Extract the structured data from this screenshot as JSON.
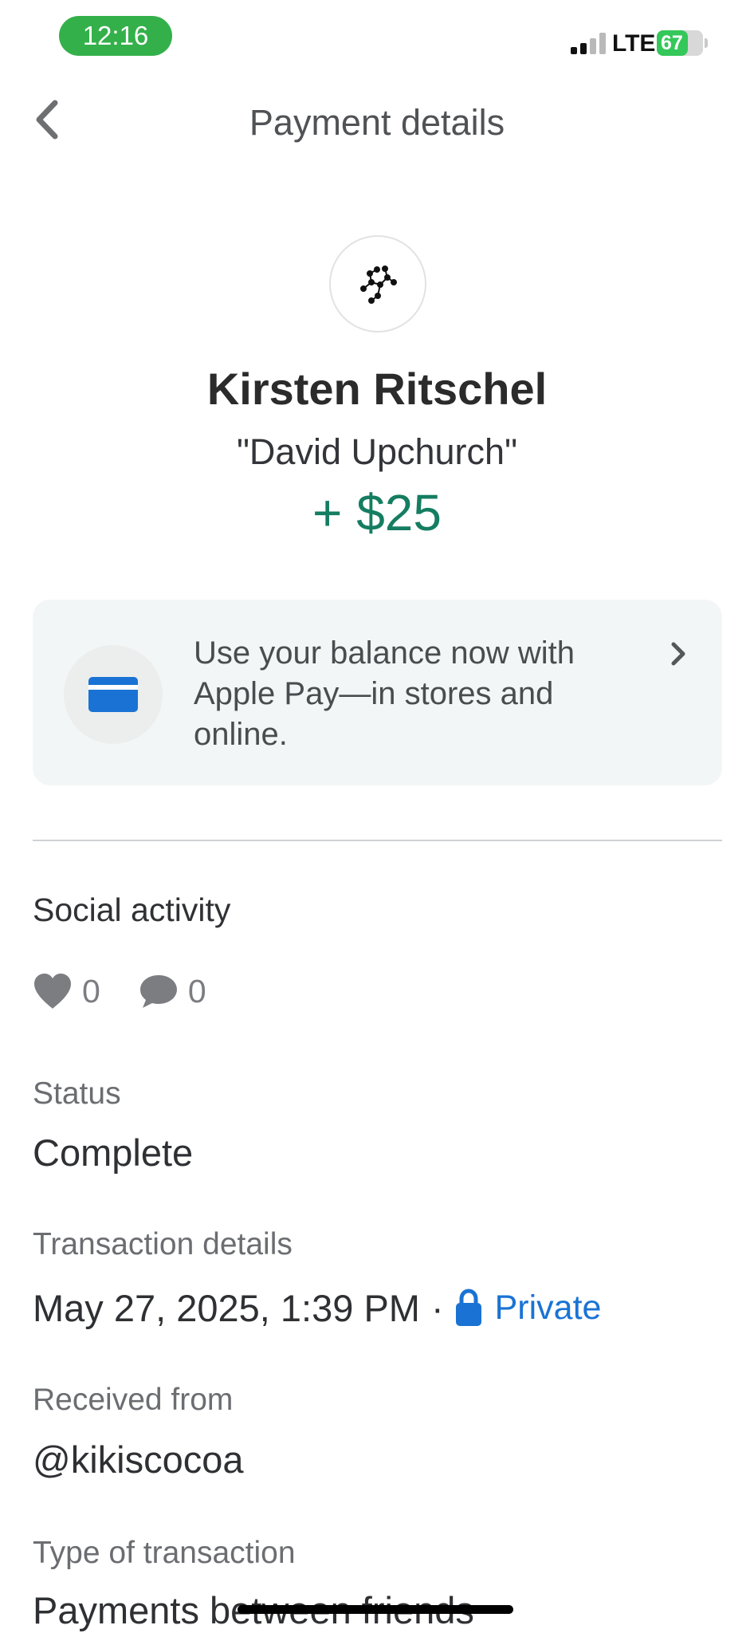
{
  "status_bar": {
    "time": "12:16",
    "network": "LTE",
    "battery": "67",
    "battery_level": 0.67
  },
  "header": {
    "title": "Payment details"
  },
  "payment": {
    "name": "Kirsten Ritschel",
    "note": "\"David Upchurch\"",
    "amount": "+ $25",
    "amount_color": "#157d61"
  },
  "promo": {
    "text": "Use your balance now with Apple Pay—in stores and online.",
    "icon_color": "#1a73d4"
  },
  "social": {
    "heading": "Social activity",
    "likes": "0",
    "comments": "0"
  },
  "details": {
    "status_label": "Status",
    "status_value": "Complete",
    "transaction_label": "Transaction details",
    "transaction_date": "May 27, 2025, 1:39 PM",
    "separator": "·",
    "privacy": "Private",
    "received_label": "Received from",
    "received_value": "@kikiscocoa",
    "type_label": "Type of transaction",
    "type_value": "Payments between friends"
  }
}
